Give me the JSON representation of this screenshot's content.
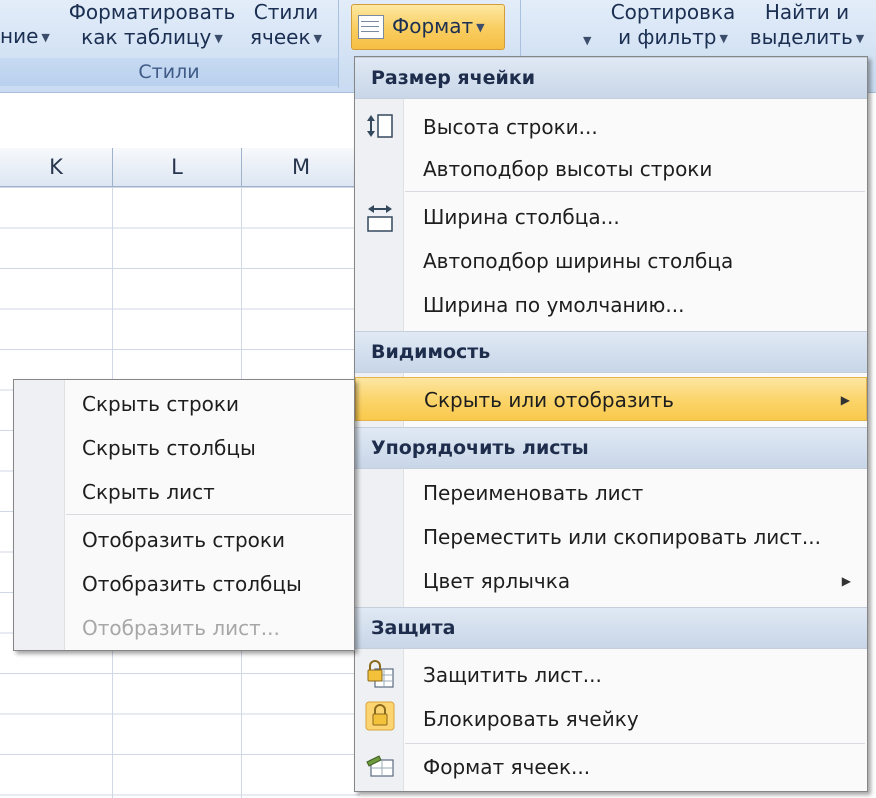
{
  "ribbon": {
    "cut_left_label": "ние",
    "format_as_table": [
      "Форматировать",
      "как таблицу"
    ],
    "cell_styles": [
      "Стили",
      "ячеек"
    ],
    "styles_group_label": "Стили",
    "format_button": "Формат",
    "sort_filter": [
      "Сортировка",
      "и фильтр"
    ],
    "find_select": [
      "Найти и",
      "выделить"
    ]
  },
  "sheet": {
    "columns": [
      "K",
      "L",
      "M"
    ]
  },
  "format_menu": {
    "sections": {
      "cell_size": "Размер ячейки",
      "visibility": "Видимость",
      "organize_sheets": "Упорядочить листы",
      "protection": "Защита"
    },
    "items": {
      "row_height": "Высота строки...",
      "autofit_row_height": "Автоподбор высоты строки",
      "column_width": "Ширина столбца...",
      "autofit_column_width": "Автоподбор ширины столбца",
      "default_width": "Ширина по умолчанию...",
      "hide_unhide": "Скрыть или отобразить",
      "rename_sheet": "Переименовать лист",
      "move_copy_sheet": "Переместить или скопировать лист...",
      "tab_color": "Цвет ярлычка",
      "protect_sheet": "Защитить лист...",
      "lock_cell": "Блокировать ячейку",
      "format_cells": "Формат ячеек..."
    }
  },
  "hide_submenu": {
    "items": {
      "hide_rows": "Скрыть строки",
      "hide_columns": "Скрыть столбцы",
      "hide_sheet": "Скрыть лист",
      "unhide_rows": "Отобразить строки",
      "unhide_columns": "Отобразить столбцы",
      "unhide_sheet": "Отобразить лист..."
    }
  }
}
